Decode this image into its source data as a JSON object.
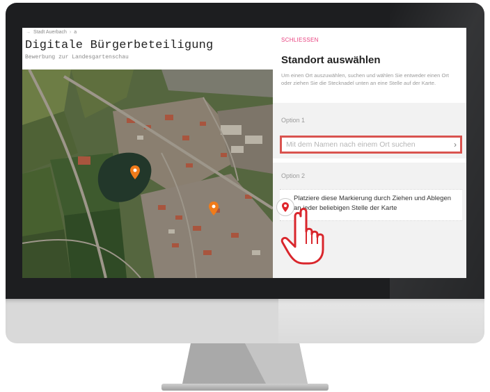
{
  "breadcrumb": {
    "items": [
      "Stadt Auerbach",
      "a"
    ]
  },
  "page": {
    "title": "Digitale Bürgerbeteiligung",
    "subtitle": "Bewerbung zur Landesgartenschau"
  },
  "panel": {
    "close_label": "SCHLIESSEN",
    "title": "Standort auswählen",
    "description": "Um einen Ort auszuwählen, suchen und wählen Sie entweder einen Ort oder ziehen Sie die Stecknadel unten an eine Stelle auf der Karte.",
    "option1": {
      "label": "Option 1",
      "search_text": "Mit dem Namen nach einem Ort suchen"
    },
    "option2": {
      "label": "Option 2",
      "drag_text": "Platziere diese Markierung durch Ziehen und Ablegen an jeder beliebigen Stelle der Karte"
    }
  },
  "colors": {
    "accent": "#e8417f",
    "highlight_border": "#d9534f",
    "map_marker": "#f07b1a",
    "pin": "#e0262c"
  },
  "icons": [
    "map-marker-icon",
    "chevron-right-icon",
    "location-pin-icon",
    "hand-pointer-icon"
  ]
}
